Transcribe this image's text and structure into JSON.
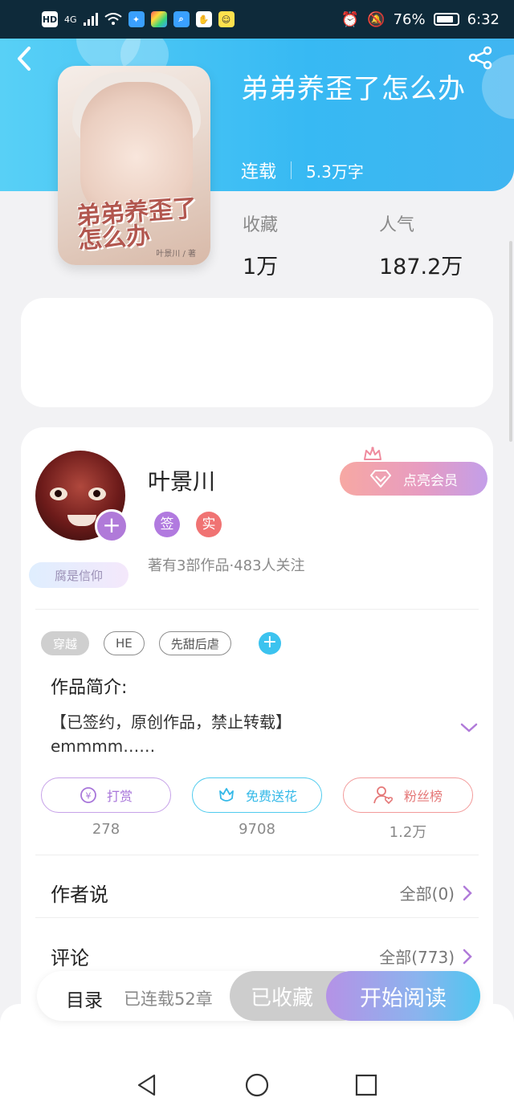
{
  "status_bar": {
    "left_icons": [
      "HD",
      "4G",
      "signal-icon",
      "wifi-icon",
      "bulb-icon",
      "app-icon",
      "search-app-icon",
      "hand-icon",
      "chat-icon"
    ],
    "hd": "HD",
    "net": "4G",
    "battery": "76%",
    "time": "6:32"
  },
  "book": {
    "title": "弟弟养歪了怎么办",
    "status": "连载",
    "words": "5.3万字",
    "cover_title": "弟弟养歪了怎么办",
    "cover_author": "叶景川 / 著"
  },
  "stats": {
    "favorites_label": "收藏",
    "favorites_value": "1万",
    "popularity_label": "人气",
    "popularity_value": "187.2万"
  },
  "author": {
    "name": "叶景川",
    "badge_sign": "签",
    "badge_real": "实",
    "info": "著有3部作品·483人关注",
    "fan_tag": "腐是信仰",
    "vip_button": "点亮会员"
  },
  "tags": [
    "穿越",
    "HE",
    "先甜后虐"
  ],
  "intro": {
    "title": "作品简介:",
    "line1": "【已签约，原创作品，禁止转载】",
    "line2": "emmmm……"
  },
  "actions": [
    {
      "label": "打赏",
      "count": "278"
    },
    {
      "label": "免费送花",
      "count": "9708"
    },
    {
      "label": "粉丝榜",
      "count": "1.2万"
    }
  ],
  "author_says": {
    "title": "作者说",
    "right": "全部(0)"
  },
  "comments": {
    "title": "评论",
    "right": "全部(773)"
  },
  "read_bar": {
    "toc": "目录",
    "chapters": "已连载52章",
    "collected": "已收藏",
    "start": "开始阅读"
  },
  "colors": {
    "header_blue": "#37b9f3",
    "purple": "#b07ad9",
    "cyan": "#3cc3ef",
    "coral": "#f07373"
  }
}
